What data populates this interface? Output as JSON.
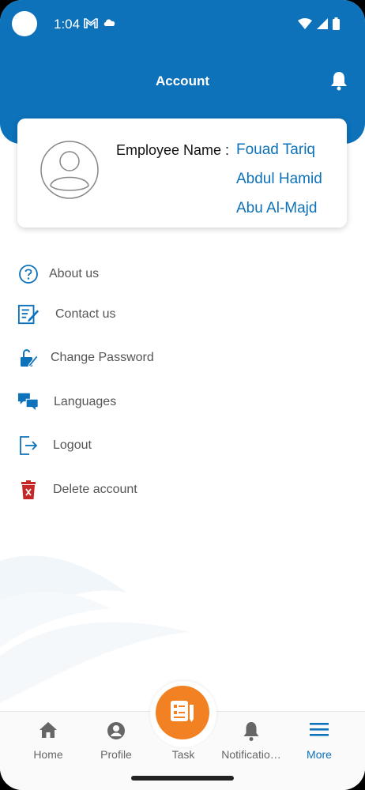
{
  "status_bar": {
    "time": "1:04"
  },
  "header": {
    "title": "Account"
  },
  "profile": {
    "label": "Employee Name :",
    "name_lines": [
      "Fouad Tariq",
      "Abdul Hamid",
      "Abu Al-Majd"
    ]
  },
  "menu": {
    "items": [
      {
        "label": "About us",
        "icon": "help-circle-icon"
      },
      {
        "label": "Contact us",
        "icon": "edit-document-icon"
      },
      {
        "label": "Change Password",
        "icon": "unlock-icon"
      },
      {
        "label": "Languages",
        "icon": "chat-bubbles-icon"
      },
      {
        "label": "Logout",
        "icon": "logout-icon"
      },
      {
        "label": "Delete account",
        "icon": "trash-icon"
      }
    ]
  },
  "bottom_nav": {
    "items": [
      {
        "label": "Home",
        "icon": "home-icon"
      },
      {
        "label": "Profile",
        "icon": "person-icon"
      },
      {
        "label": "Task",
        "icon": "task-icon"
      },
      {
        "label": "Notificatio…",
        "icon": "bell-icon"
      },
      {
        "label": "More",
        "icon": "menu-icon"
      }
    ],
    "active": "More"
  },
  "colors": {
    "primary": "#0d72ba",
    "fab": "#f28123",
    "danger": "#c62828"
  }
}
